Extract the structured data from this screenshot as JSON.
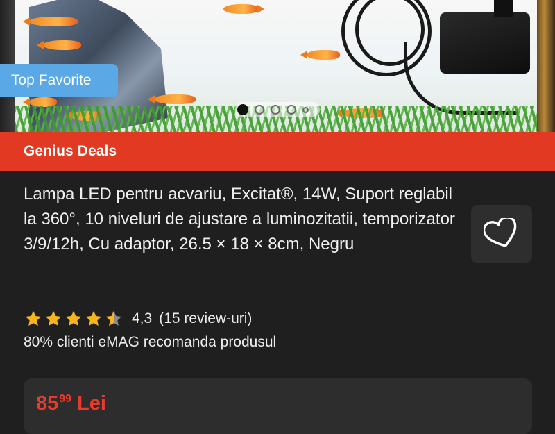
{
  "product_image": {
    "badge": "Top Favorite",
    "carousel": {
      "total": 5,
      "active_index": 0
    }
  },
  "promo_strip": {
    "label": "Genius Deals"
  },
  "product": {
    "title": "Lampa LED pentru acvariu, Excitat®, 14W, Suport reglabil la 360°, 10 niveluri de ajustare a luminozitatii, temporizator 3/9/12h, Cu adaptor, 26.5 × 18 × 8cm, Negru",
    "favorite_icon": "heart-icon"
  },
  "rating": {
    "value": "4,3",
    "stars_fraction": 0.86,
    "review_count": "(15 review-uri)"
  },
  "recommendation": {
    "text": "80% clienti eMAG recomanda produsul"
  },
  "price": {
    "integer": "85",
    "cents": "99",
    "currency": "Lei"
  },
  "colors": {
    "accent_red": "#e23a22",
    "price_red": "#ea3a2c",
    "badge_blue": "#5aa9e6",
    "star_gold": "#f5b51f",
    "background": "#1f1f1f"
  }
}
